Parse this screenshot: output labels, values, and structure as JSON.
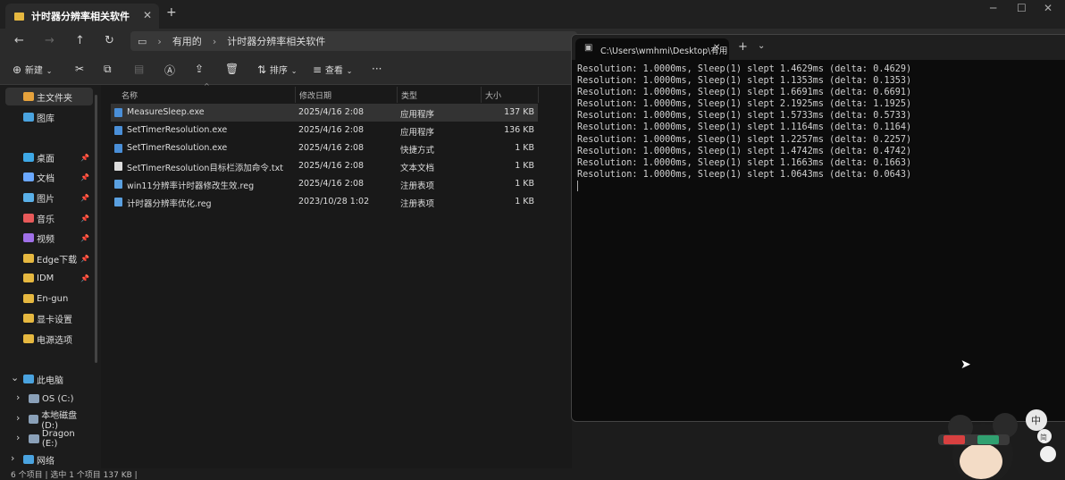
{
  "explorer": {
    "tab_title": "计时器分辨率相关软件",
    "breadcrumb": [
      "有用的",
      "计时器分辨率相关软件"
    ],
    "toolbar": {
      "new": "新建",
      "sort": "排序",
      "view": "查看"
    },
    "sidebar": [
      {
        "label": "主文件夹",
        "color": "#e6a23c"
      },
      {
        "label": "图库",
        "color": "#4aa3df"
      },
      {
        "label": "桌面",
        "color": "#3ea8e6",
        "pinned": true
      },
      {
        "label": "文档",
        "color": "#6aa8ff",
        "pinned": true
      },
      {
        "label": "图片",
        "color": "#5ab0e8",
        "pinned": true
      },
      {
        "label": "音乐",
        "color": "#e85a5a",
        "pinned": true
      },
      {
        "label": "视频",
        "color": "#a070e8",
        "pinned": true
      },
      {
        "label": "Edge下载",
        "color": "#e6b840",
        "pinned": true
      },
      {
        "label": "IDM",
        "color": "#e6b840",
        "pinned": true
      },
      {
        "label": "En-gun",
        "color": "#e6b840"
      },
      {
        "label": "显卡设置",
        "color": "#e6b840"
      },
      {
        "label": "电源选项",
        "color": "#e6b840"
      },
      {
        "label": "此电脑",
        "color": "#4aa3df"
      },
      {
        "label": "OS (C:)",
        "color": "#8aa0b8"
      },
      {
        "label": "本地磁盘 (D:)",
        "color": "#8aa0b8"
      },
      {
        "label": "Dragon (E:)",
        "color": "#8aa0b8"
      },
      {
        "label": "网络",
        "color": "#4aa3df"
      }
    ],
    "columns": [
      "名称",
      "修改日期",
      "类型",
      "大小"
    ],
    "files": [
      {
        "name": "MeasureSleep.exe",
        "date": "2025/4/16 2:08",
        "type": "应用程序",
        "size": "137 KB",
        "color": "#4a8fd8"
      },
      {
        "name": "SetTimerResolution.exe",
        "date": "2025/4/16 2:08",
        "type": "应用程序",
        "size": "136 KB",
        "color": "#4a8fd8"
      },
      {
        "name": "SetTimerResolution.exe",
        "date": "2025/4/16 2:08",
        "type": "快捷方式",
        "size": "1 KB",
        "color": "#4a8fd8"
      },
      {
        "name": "SetTimerResolution目标栏添加命令.txt",
        "date": "2025/4/16 2:08",
        "type": "文本文档",
        "size": "1 KB",
        "color": "#dddddd"
      },
      {
        "name": "win11分辨率计时器修改生效.reg",
        "date": "2025/4/16 2:08",
        "type": "注册表项",
        "size": "1 KB",
        "color": "#5aa0e0"
      },
      {
        "name": "计时器分辨率优化.reg",
        "date": "2023/10/28 1:02",
        "type": "注册表项",
        "size": "1 KB",
        "color": "#5aa0e0"
      }
    ],
    "status": "6 个项目  |  选中 1 个项目  137 KB  |"
  },
  "terminal": {
    "tab_title": "C:\\Users\\wmhmi\\Desktop\\有用",
    "lines": [
      "Resolution: 1.0000ms, Sleep(1) slept 1.4629ms (delta: 0.4629)",
      "Resolution: 1.0000ms, Sleep(1) slept 1.1353ms (delta: 0.1353)",
      "Resolution: 1.0000ms, Sleep(1) slept 1.6691ms (delta: 0.6691)",
      "Resolution: 1.0000ms, Sleep(1) slept 2.1925ms (delta: 1.1925)",
      "Resolution: 1.0000ms, Sleep(1) slept 1.5733ms (delta: 0.5733)",
      "Resolution: 1.0000ms, Sleep(1) slept 1.1164ms (delta: 0.1164)",
      "Resolution: 1.0000ms, Sleep(1) slept 1.2257ms (delta: 0.2257)",
      "Resolution: 1.0000ms, Sleep(1) slept 1.4742ms (delta: 0.4742)",
      "Resolution: 1.0000ms, Sleep(1) slept 1.1663ms (delta: 0.1663)",
      "Resolution: 1.0000ms, Sleep(1) slept 1.0643ms (delta: 0.0643)"
    ]
  },
  "overlay": {
    "badge_top": "中",
    "badge_bottom": "简"
  }
}
